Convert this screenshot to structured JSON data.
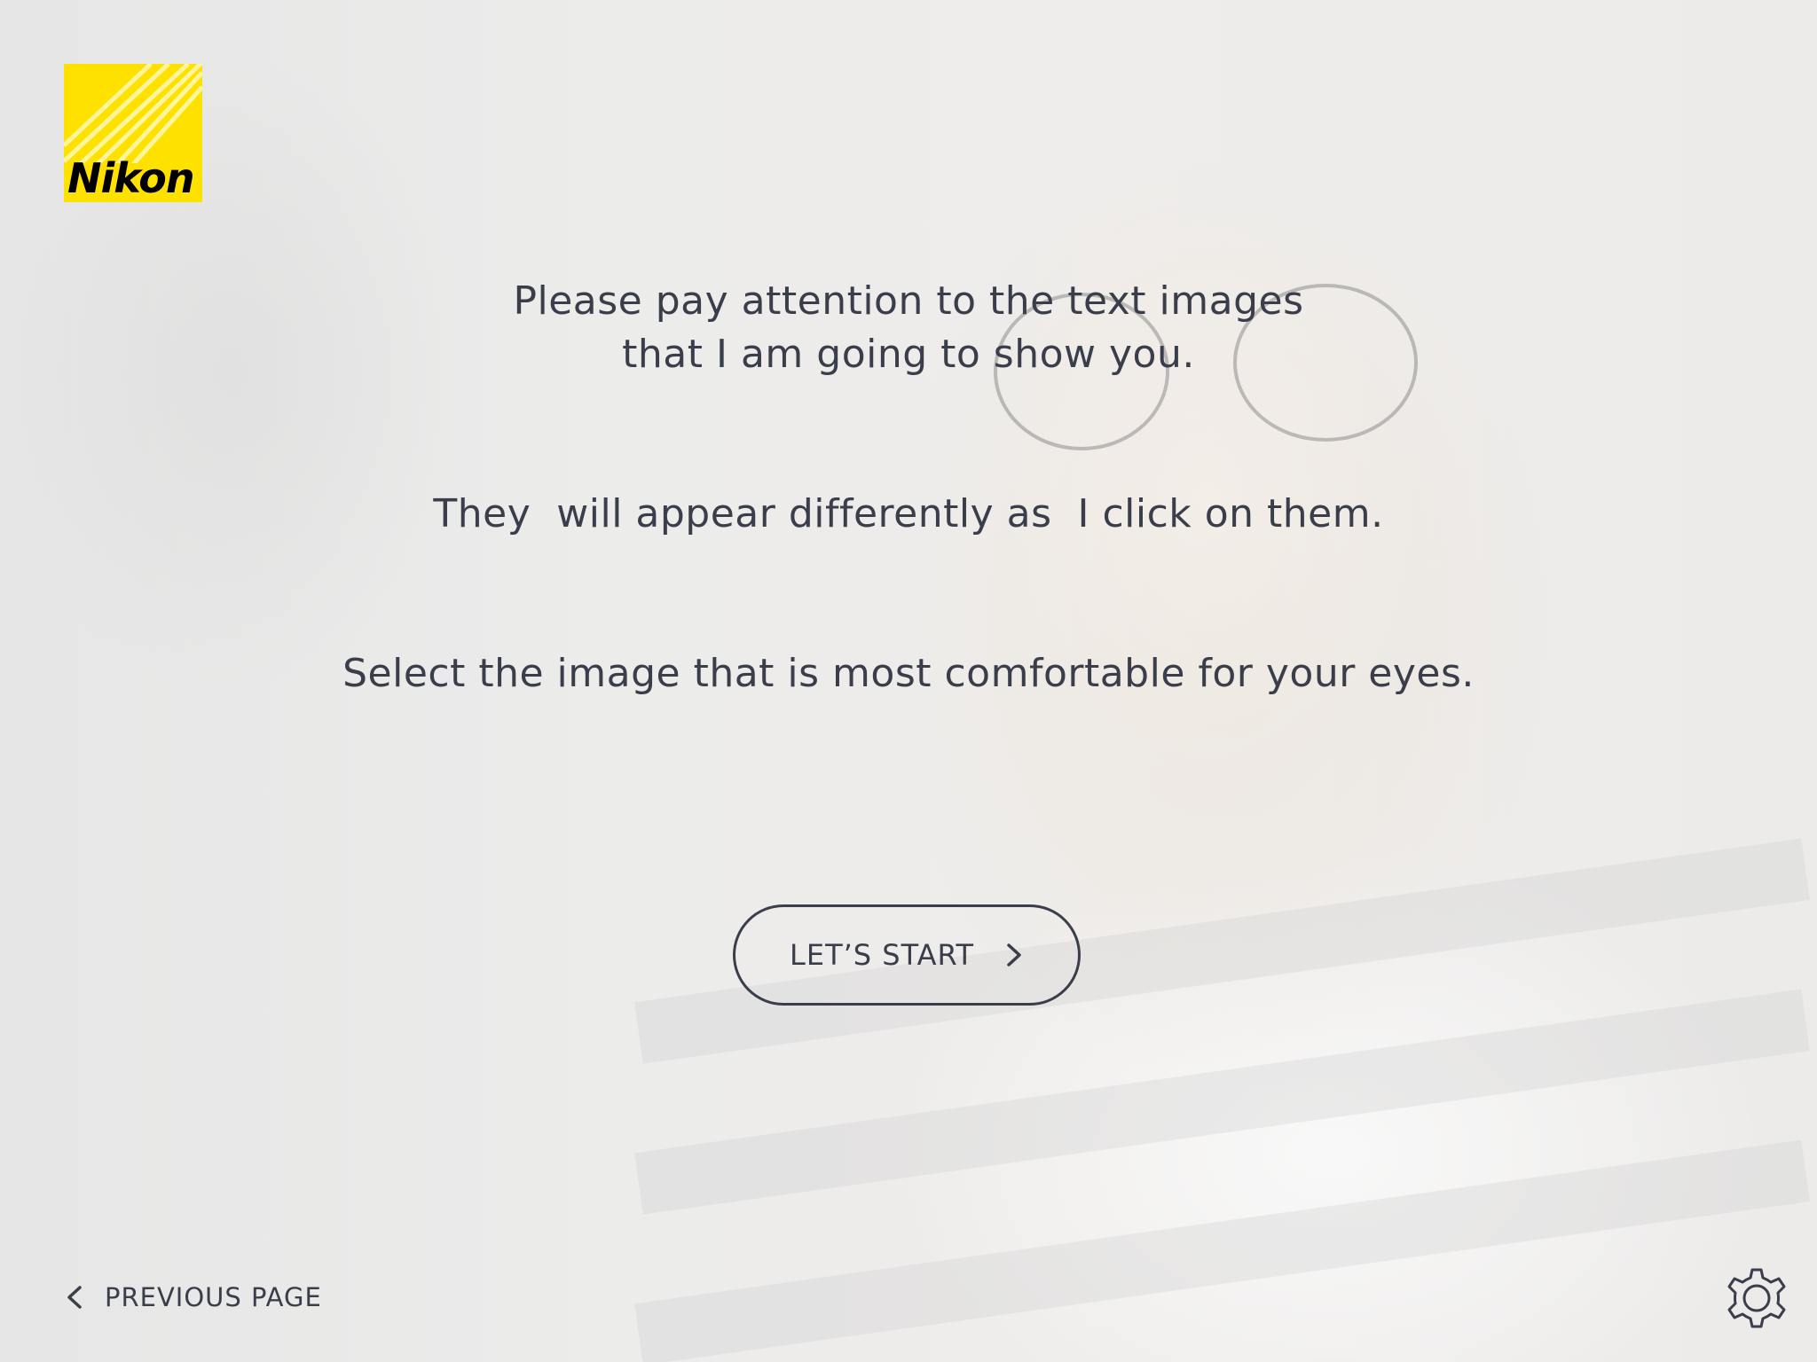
{
  "brand": {
    "logo_text": "Nikon",
    "logo_color": "#ffe100"
  },
  "instructions": {
    "line1": "Please pay attention to the text images",
    "line2": "that I am going to show you.",
    "line3": "They  will appear differently as  I click on them.",
    "line4": "Select the image that is most comfortable for your eyes."
  },
  "start_button": {
    "label": "LET’S START",
    "icon": "chevron-right-icon"
  },
  "footer": {
    "previous_label": "PREVIOUS PAGE",
    "previous_icon": "chevron-left-icon",
    "settings_icon": "gear-icon"
  },
  "colors": {
    "text": "#3a3d4a",
    "background": "#ececeb"
  }
}
